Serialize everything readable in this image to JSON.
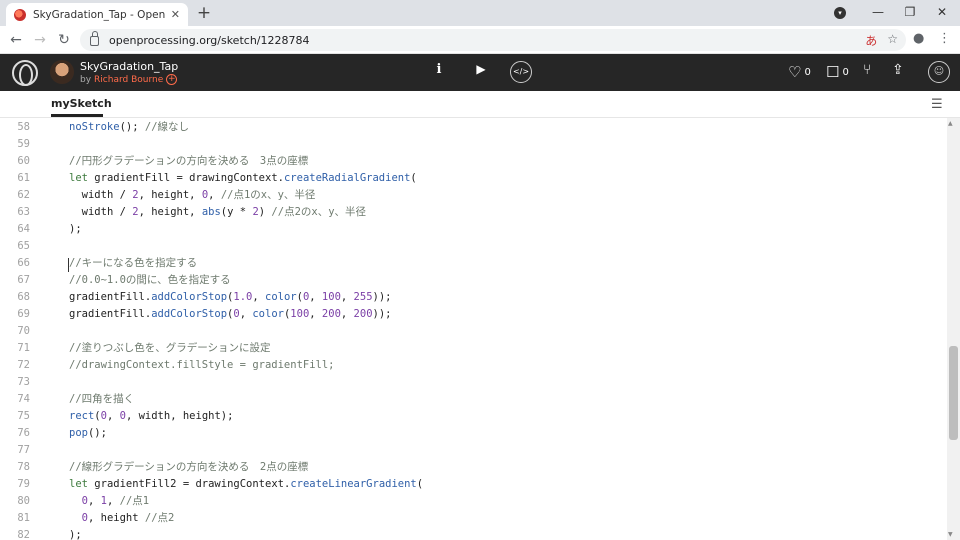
{
  "browser": {
    "tab_title": "SkyGradation_Tap - OpenProcessing",
    "url": "openprocessing.org/sketch/1228784"
  },
  "header": {
    "sketch_title": "SkyGradation_Tap",
    "by_label": "by",
    "author": "Richard Bourne",
    "likes_count": "0",
    "comments_count": "0"
  },
  "editor": {
    "file_tab": "mySketch",
    "lines": [
      {
        "n": "58",
        "code": "  noStroke(); //線なし"
      },
      {
        "n": "59",
        "code": ""
      },
      {
        "n": "60",
        "code": "  //円形グラデーションの方向を決める　3点の座標"
      },
      {
        "n": "61",
        "code": "  let gradientFill = drawingContext.createRadialGradient("
      },
      {
        "n": "62",
        "code": "    width / 2, height, 0, //点1のx、y、半径"
      },
      {
        "n": "63",
        "code": "    width / 2, height, abs(y * 2) //点2のx、y、半径"
      },
      {
        "n": "64",
        "code": "  );"
      },
      {
        "n": "65",
        "code": ""
      },
      {
        "n": "66",
        "code": "  //キーになる色を指定する"
      },
      {
        "n": "67",
        "code": "  //0.0~1.0の間に、色を指定する"
      },
      {
        "n": "68",
        "code": "  gradientFill.addColorStop(1.0, color(0, 100, 255));"
      },
      {
        "n": "69",
        "code": "  gradientFill.addColorStop(0, color(100, 200, 200));"
      },
      {
        "n": "70",
        "code": ""
      },
      {
        "n": "71",
        "code": "  //塗りつぶし色を、グラデーションに設定"
      },
      {
        "n": "72",
        "code": "  //drawingContext.fillStyle = gradientFill;"
      },
      {
        "n": "73",
        "code": ""
      },
      {
        "n": "74",
        "code": "  //四角を描く"
      },
      {
        "n": "75",
        "code": "  rect(0, 0, width, height);"
      },
      {
        "n": "76",
        "code": "  pop();"
      },
      {
        "n": "77",
        "code": ""
      },
      {
        "n": "78",
        "code": "  //線形グラデーションの方向を決める　2点の座標"
      },
      {
        "n": "79",
        "code": "  let gradientFill2 = drawingContext.createLinearGradient("
      },
      {
        "n": "80",
        "code": "    0, 1, //点1"
      },
      {
        "n": "81",
        "code": "    0, height //点2"
      },
      {
        "n": "82",
        "code": "  );"
      }
    ]
  },
  "colors": {
    "header_bg": "#262626",
    "accent": "#ff6b4a",
    "comment": "#6e7a6e",
    "keyword": "#3d7a3d",
    "function": "#2f5fa8",
    "number": "#7b3fa6"
  }
}
